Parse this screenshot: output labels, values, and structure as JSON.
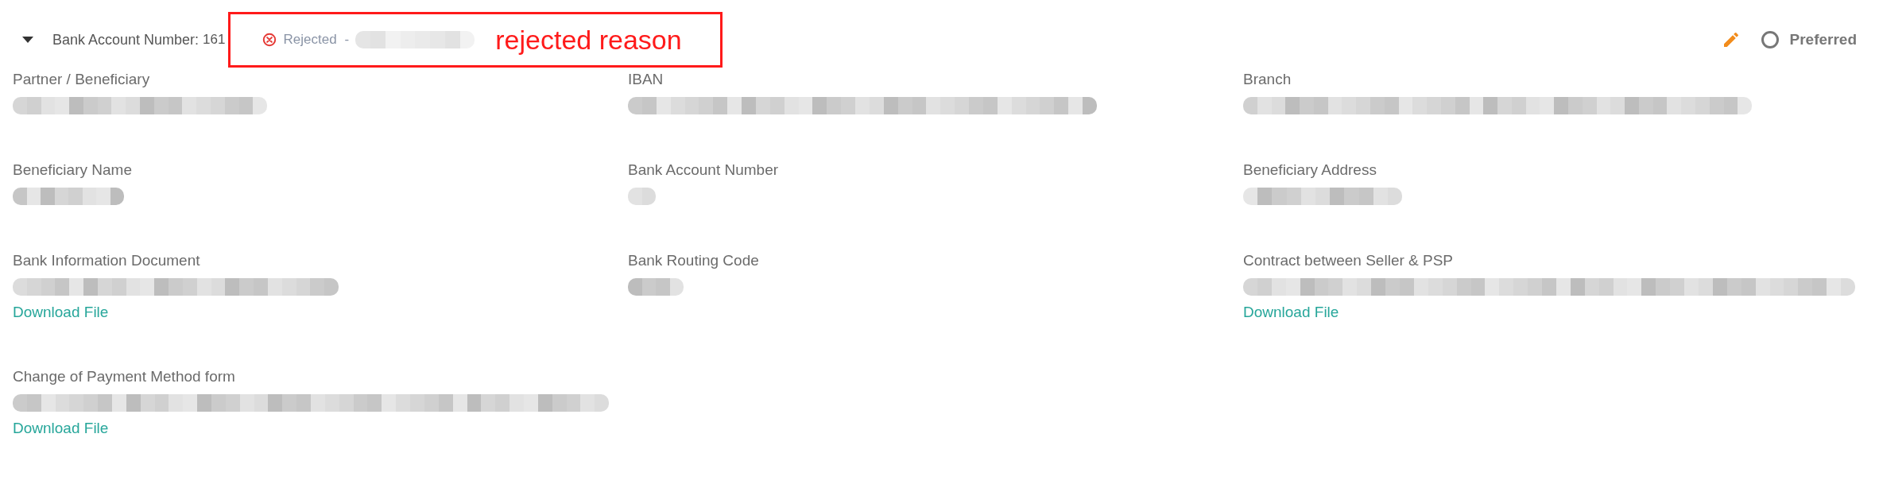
{
  "header": {
    "expanded": true,
    "label": "Bank Account Number:",
    "value": "161",
    "status": {
      "kind": "rejected",
      "label": "Rejected",
      "separator": "-",
      "redacted": true
    },
    "annotation": "rejected reason",
    "edit": true,
    "preferred": {
      "label": "Preferred",
      "selected": false
    }
  },
  "fields": [
    {
      "label": "Partner / Beneficiary",
      "redacted": true
    },
    {
      "label": "IBAN",
      "redacted": true
    },
    {
      "label": "Branch",
      "redacted": true
    },
    {
      "label": "Beneficiary Name",
      "redacted": true
    },
    {
      "label": "Bank Account Number",
      "redacted": true
    },
    {
      "label": "Beneficiary Address",
      "redacted": true
    },
    {
      "label": "Bank Information Document",
      "redacted": true,
      "link": "Download File"
    },
    {
      "label": "Bank Routing Code",
      "redacted": true
    },
    {
      "label": "Contract between Seller & PSP",
      "redacted": true,
      "link": "Download File"
    },
    {
      "label": "Change of Payment Method form",
      "redacted": true,
      "link": "Download File"
    }
  ]
}
